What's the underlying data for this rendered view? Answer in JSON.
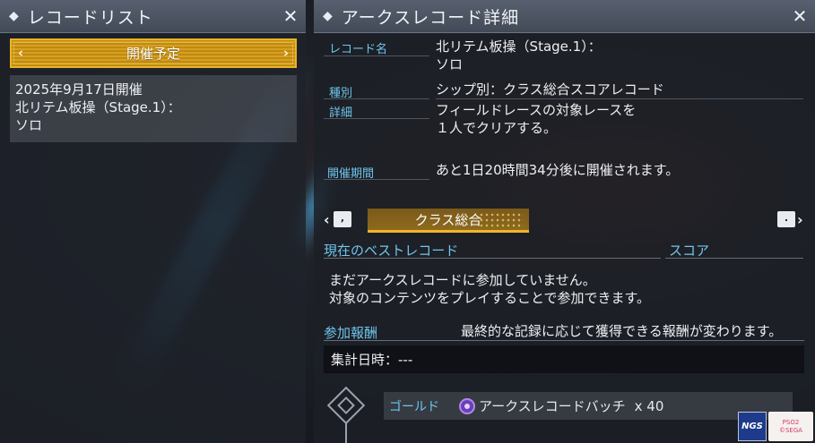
{
  "left_panel": {
    "title": "レコードリスト",
    "tab_label": "開催予定",
    "record": {
      "date": "2025年9月17日開催",
      "name_line1": "北リテム板操（Stage.1）：",
      "name_line2": "ソロ"
    }
  },
  "right_panel": {
    "title": "アークスレコード詳細",
    "fields": {
      "record_name_label": "レコード名",
      "record_name_line1": "北リテム板操（Stage.1）：",
      "record_name_line2": "ソロ",
      "type_label": "種別",
      "type_value": "シップ別：クラス総合スコアレコード",
      "detail_label": "詳細",
      "detail_line1": "フィールドレースの対象レースを",
      "detail_line2": "１人でクリアする。",
      "period_label": "開催期間",
      "period_value": "あと1日20時間34分後に開催されます。"
    },
    "class_tab": "クラス総合",
    "nav_left_key": ",",
    "nav_right_key": ".",
    "best_record_header": "現在のベストレコード",
    "score_header": "スコア",
    "no_record_line1": "まだアークスレコードに参加していません。",
    "no_record_line2": "対象のコンテンツをプレイすることで参加できます。",
    "reward_header": "参加報酬",
    "reward_note": "最終的な記録に応じて獲得できる報酬が変わります。",
    "tally_time": "集計日時：---",
    "reward_row": {
      "tier": "ゴールド",
      "item": "アークスレコードバッチ",
      "quantity": "x 40"
    }
  },
  "logos": {
    "ngs": "NGS",
    "sega_line1": "PSO2",
    "sega_line2": "©SEGA"
  },
  "colors": {
    "accent_blue": "#6fc6ec",
    "accent_gold": "#e8b425",
    "header_gray": "#4e5563"
  },
  "icons": [
    "diamond-icon",
    "close-icon",
    "chevron-left-icon",
    "chevron-right-icon",
    "badge-icon"
  ]
}
